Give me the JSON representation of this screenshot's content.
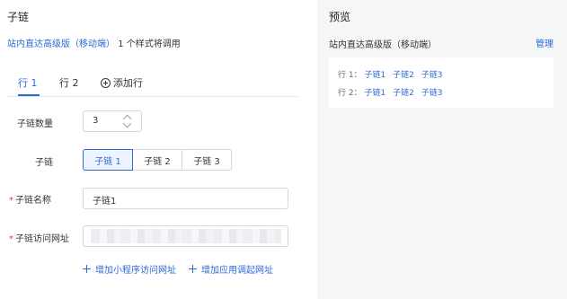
{
  "config": {
    "title": "子链",
    "desc_link": "站内直达高级版（移动端）",
    "desc_rest": "1 个样式将调用",
    "tabs": [
      {
        "label": "行 1",
        "active": true
      },
      {
        "label": "行 2",
        "active": false
      }
    ],
    "add_row_label": "添加行",
    "count_label": "子链数量",
    "count_value": "3",
    "sublink_label": "子链",
    "segments": [
      {
        "label": "子链 1",
        "active": true
      },
      {
        "label": "子链 2",
        "active": false
      },
      {
        "label": "子链 3",
        "active": false
      }
    ],
    "name_label": "子链名称",
    "name_value": "子链1",
    "url_label": "子链访问网址",
    "required_mark": "*",
    "add_mini_label": "增加小程序访问网址",
    "add_app_label": "增加应用调起网址"
  },
  "preview": {
    "title": "预览",
    "subtitle": "站内直达高级版（移动端）",
    "manage_label": "管理",
    "rows": [
      {
        "label": "行 1：",
        "links": [
          "子链1",
          "子链2",
          "子链3"
        ]
      },
      {
        "label": "行 2：",
        "links": [
          "子链1",
          "子链2",
          "子链3"
        ]
      }
    ]
  },
  "colors": {
    "accent": "#2d6ad8",
    "required": "#e23a3a",
    "preview_bg": "#f5f6f8"
  }
}
